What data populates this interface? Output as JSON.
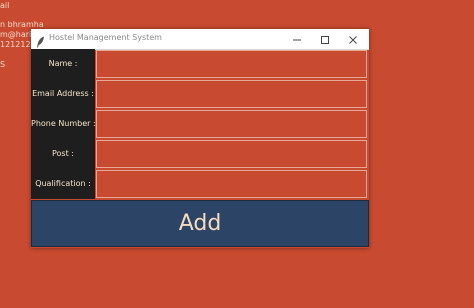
{
  "background_lines": [
    "ail",
    "n bhramha",
    "m@hari.",
    "121212",
    "S"
  ],
  "window": {
    "title": "Hostel Management System",
    "minimize_glyph": "—",
    "maximize_glyph": "☐",
    "close_glyph": "✕"
  },
  "form": {
    "fields": [
      {
        "label": "Name :",
        "value": ""
      },
      {
        "label": "Email Address :",
        "value": ""
      },
      {
        "label": "Phone Number :",
        "value": ""
      },
      {
        "label": "Post :",
        "value": ""
      },
      {
        "label": "Qualification :",
        "value": ""
      }
    ],
    "add_label": "Add"
  },
  "colors": {
    "background": "#c84a30",
    "label_panel": "#1e1e1e",
    "label_text": "#f4e4c8",
    "button": "#2c4466",
    "button_text": "#f6dcbf"
  },
  "icons": [
    "feather-icon",
    "minimize-icon",
    "maximize-icon",
    "close-icon"
  ]
}
